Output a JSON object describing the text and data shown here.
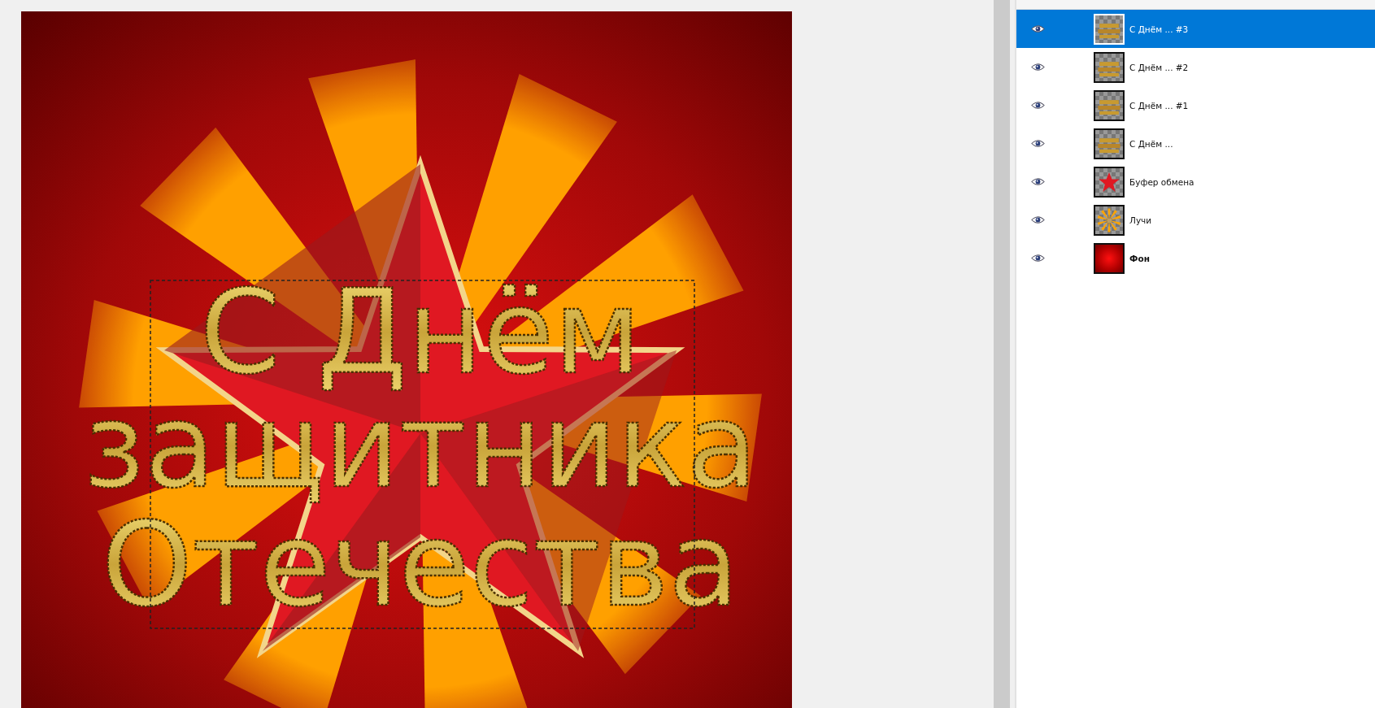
{
  "canvas": {
    "text_lines": [
      "С Днём",
      "защитника",
      "Отечества"
    ]
  },
  "layers": [
    {
      "name": "С Днём ... #3",
      "kind": "text",
      "visible": true,
      "selected": true
    },
    {
      "name": "С Днём ... #2",
      "kind": "text",
      "visible": true,
      "selected": false
    },
    {
      "name": "С Днём ... #1",
      "kind": "text",
      "visible": true,
      "selected": false
    },
    {
      "name": "С Днём ...",
      "kind": "text",
      "visible": true,
      "selected": false
    },
    {
      "name": "Буфер обмена",
      "kind": "star",
      "visible": true,
      "selected": false
    },
    {
      "name": "Лучи",
      "kind": "rays",
      "visible": true,
      "selected": false
    },
    {
      "name": "Фон",
      "kind": "background",
      "visible": true,
      "selected": false
    }
  ]
}
